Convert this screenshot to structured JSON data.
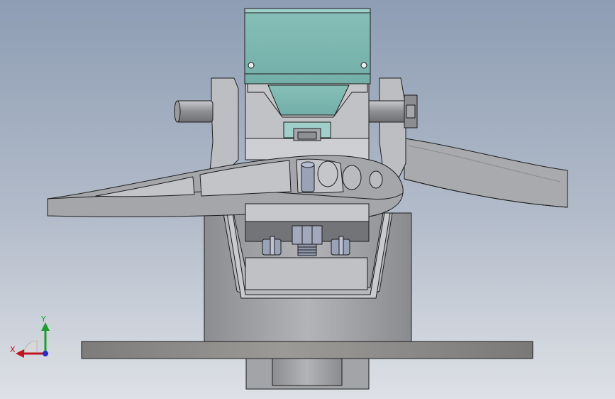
{
  "view": {
    "background_top": "#8e9db4",
    "background_bottom": "#dee1e6"
  },
  "triad": {
    "x_label": "X",
    "y_label": "Y",
    "x_color": "#c0141e",
    "y_color": "#1aa02a",
    "z_color": "#1e2ed0"
  },
  "colors": {
    "gray_light": "#c4c6ca",
    "gray_mid": "#a8a9ad",
    "gray_dark": "#6e6f73",
    "teal": "#7fbab4",
    "teal_light": "#9fcfc8",
    "hardware": "#9aa2b8",
    "edge": "#1c1c1c"
  }
}
